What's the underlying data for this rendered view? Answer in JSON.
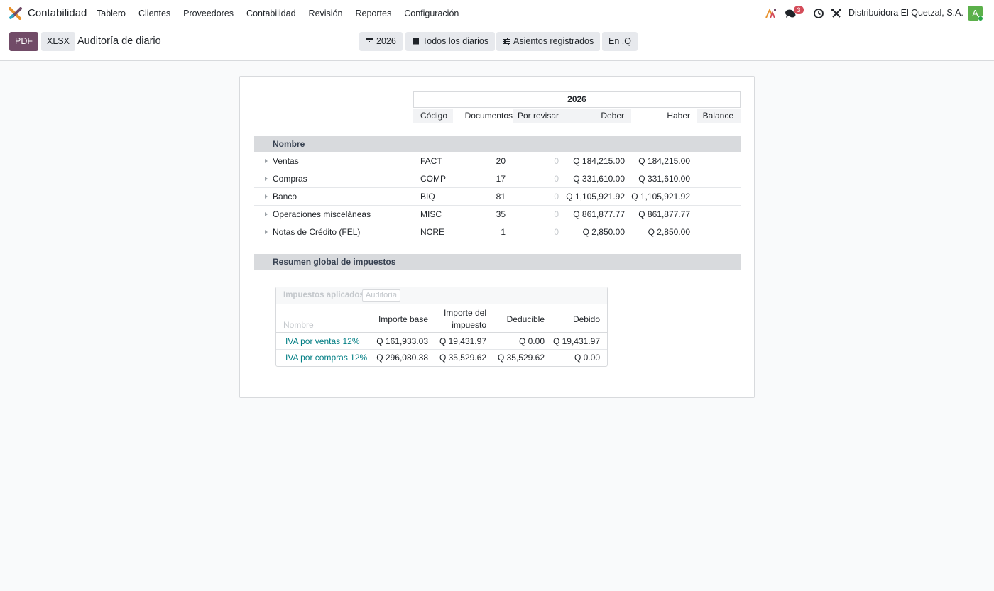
{
  "navbar": {
    "app_name": "Contabilidad",
    "menu": [
      "Tablero",
      "Clientes",
      "Proveedores",
      "Contabilidad",
      "Revisión",
      "Reportes",
      "Configuración"
    ],
    "messages_count": "3",
    "company": "Distribuidora El Quetzal, S.A.",
    "avatar_initial": "A"
  },
  "control": {
    "pdf_label": "PDF",
    "xlsx_label": "XLSX",
    "title": "Auditoría de diario",
    "filters": {
      "year": "2026",
      "journals": "Todos los diarios",
      "entries": "Asientos registrados",
      "currency": "En .Q"
    }
  },
  "report": {
    "period": "2026",
    "columns": {
      "name": "Nombre",
      "code": "Código",
      "documents": "Documentos",
      "to_review": "Por revisar",
      "debit": "Deber",
      "credit": "Haber",
      "balance": "Balance"
    },
    "rows": [
      {
        "name": "Ventas",
        "code": "FACT",
        "documents": "20",
        "to_review": "0",
        "debit": "Q 184,215.00",
        "credit": "Q 184,215.00"
      },
      {
        "name": "Compras",
        "code": "COMP",
        "documents": "17",
        "to_review": "0",
        "debit": "Q 331,610.00",
        "credit": "Q 331,610.00"
      },
      {
        "name": "Banco",
        "code": "BIQ",
        "documents": "81",
        "to_review": "0",
        "debit": "Q 1,105,921.92",
        "credit": "Q 1,105,921.92"
      },
      {
        "name": "Operaciones misceláneas",
        "code": "MISC",
        "documents": "35",
        "to_review": "0",
        "debit": "Q 861,877.77",
        "credit": "Q 861,877.77"
      },
      {
        "name": "Notas de Crédito (FEL)",
        "code": "NCRE",
        "documents": "1",
        "to_review": "0",
        "debit": "Q 2,850.00",
        "credit": "Q 2,850.00"
      }
    ],
    "tax_summary_label": "Resumen global de impuestos",
    "tax_table": {
      "tab_active": "Impuestos aplicados",
      "tab_other": "Auditoría",
      "headers": {
        "name": "Nombre",
        "base": "Importe base",
        "tax_amount_line1": "Importe del",
        "tax_amount_line2": "impuesto",
        "deductible": "Deducible",
        "due": "Debido"
      },
      "rows": [
        {
          "name": "IVA por ventas 12%",
          "base": "Q 161,933.03",
          "tax": "Q 19,431.97",
          "deductible": "Q 0.00",
          "due": "Q 19,431.97"
        },
        {
          "name": "IVA por compras 12%",
          "base": "Q 296,080.38",
          "tax": "Q 35,529.62",
          "deductible": "Q 35,529.62",
          "due": "Q 0.00"
        }
      ]
    }
  }
}
